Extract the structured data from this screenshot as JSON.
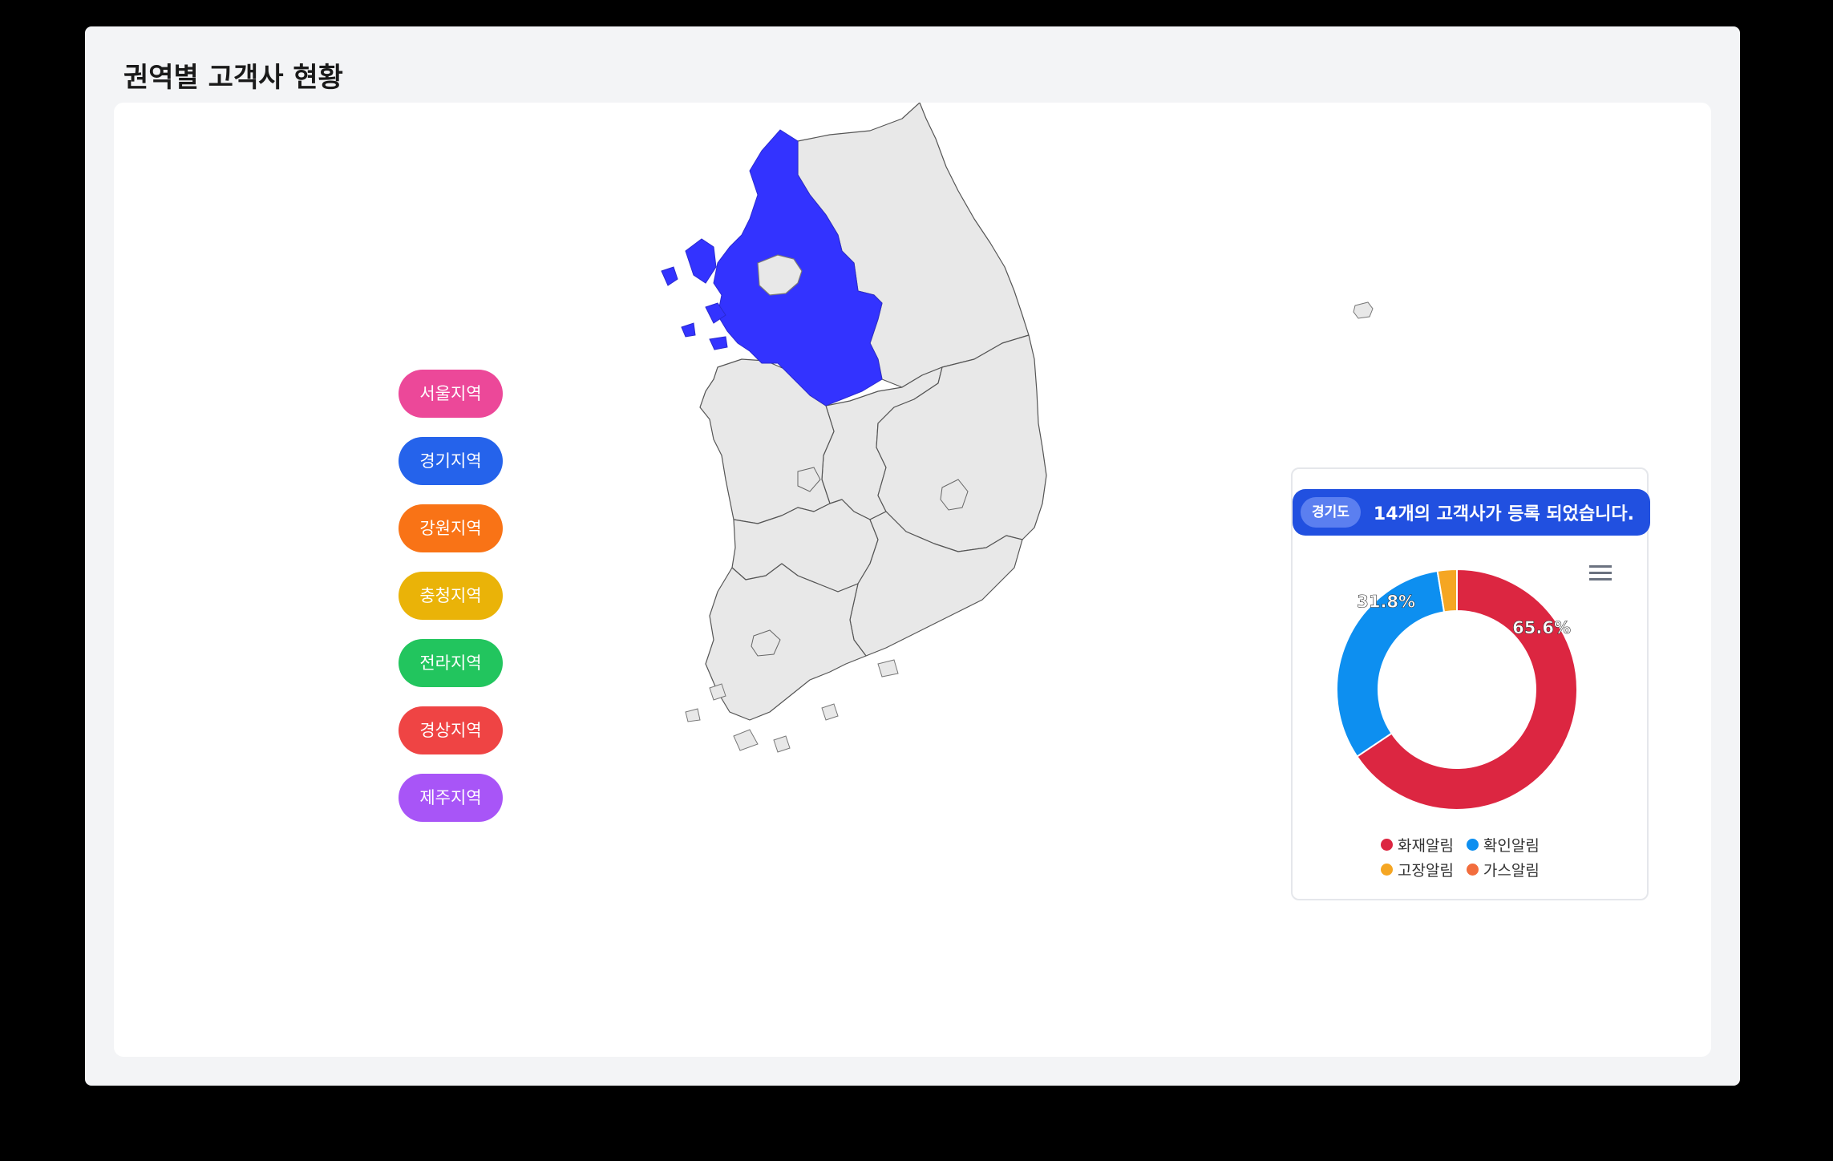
{
  "page": {
    "title": "권역별 고객사 현황"
  },
  "regions": [
    {
      "label": "서울지역",
      "color": "#ec4899"
    },
    {
      "label": "경기지역",
      "color": "#2563eb"
    },
    {
      "label": "강원지역",
      "color": "#f97316"
    },
    {
      "label": "충청지역",
      "color": "#eab308"
    },
    {
      "label": "전라지역",
      "color": "#22c55e"
    },
    {
      "label": "경상지역",
      "color": "#ef4444"
    },
    {
      "label": "제주지역",
      "color": "#a855f7"
    }
  ],
  "map": {
    "selected_region": "경기도",
    "selected_color": "#3333ff",
    "land_color": "#e8e8e8",
    "border_color": "#555555"
  },
  "info": {
    "region_tag": "경기도",
    "message": "14개의 고객사가 등록 되었습니다.",
    "banner_color": "#2150e0",
    "tag_color": "#5b7ff0"
  },
  "chart_data": {
    "type": "pie",
    "series": [
      {
        "name": "화재알림",
        "value": 65.6,
        "color": "#dc2641"
      },
      {
        "name": "확인알림",
        "value": 31.8,
        "color": "#0d8ff0"
      },
      {
        "name": "고장알림",
        "value": 2.6,
        "color": "#f5a623"
      },
      {
        "name": "가스알림",
        "value": 0,
        "color": "#f26d3d"
      }
    ],
    "data_labels": [
      "65.6%",
      "31.8%"
    ]
  }
}
